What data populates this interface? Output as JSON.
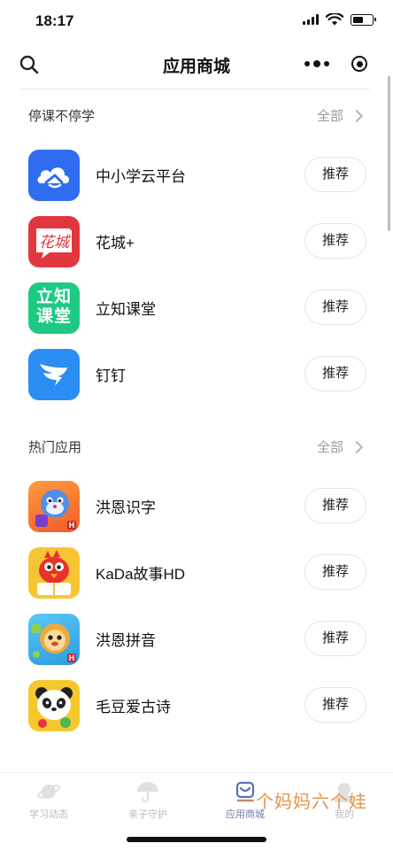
{
  "status": {
    "time": "18:17",
    "battery_level": 0.6
  },
  "nav": {
    "title": "应用商城"
  },
  "sections": [
    {
      "title": "停课不停学",
      "all_label": "全部",
      "apps": [
        {
          "name": "中小学云平台",
          "button": "推荐",
          "icon": "cloud-book-icon"
        },
        {
          "name": "花城+",
          "button": "推荐",
          "icon": "huacheng-icon",
          "icon_text": "花城"
        },
        {
          "name": "立知课堂",
          "button": "推荐",
          "icon": "lizhi-icon",
          "icon_text": "立知课堂"
        },
        {
          "name": "钉钉",
          "button": "推荐",
          "icon": "dingtalk-icon"
        }
      ]
    },
    {
      "title": "热门应用",
      "all_label": "全部",
      "apps": [
        {
          "name": "洪恩识字",
          "button": "推荐",
          "icon": "tiger-mascot-icon"
        },
        {
          "name": "KaDa故事HD",
          "button": "推荐",
          "icon": "bird-mascot-icon"
        },
        {
          "name": "洪恩拼音",
          "button": "推荐",
          "icon": "lion-mascot-icon"
        },
        {
          "name": "毛豆爱古诗",
          "button": "推荐",
          "icon": "panda-mascot-icon"
        }
      ]
    }
  ],
  "tabs": [
    {
      "label": "学习动态",
      "icon": "planet-icon",
      "active": false
    },
    {
      "label": "亲子守护",
      "icon": "umbrella-icon",
      "active": false
    },
    {
      "label": "应用商城",
      "icon": "store-icon",
      "active": true
    },
    {
      "label": "我的",
      "icon": "profile-icon",
      "active": false
    }
  ],
  "watermark": "一个妈妈六个娃",
  "colors": {
    "accent_blue": "#2f6cf0",
    "huacheng_red": "#e2363f",
    "lizhi_green": "#1ec983",
    "dingtalk_blue": "#2a8ef5",
    "watermark_orange": "#e4944a"
  }
}
